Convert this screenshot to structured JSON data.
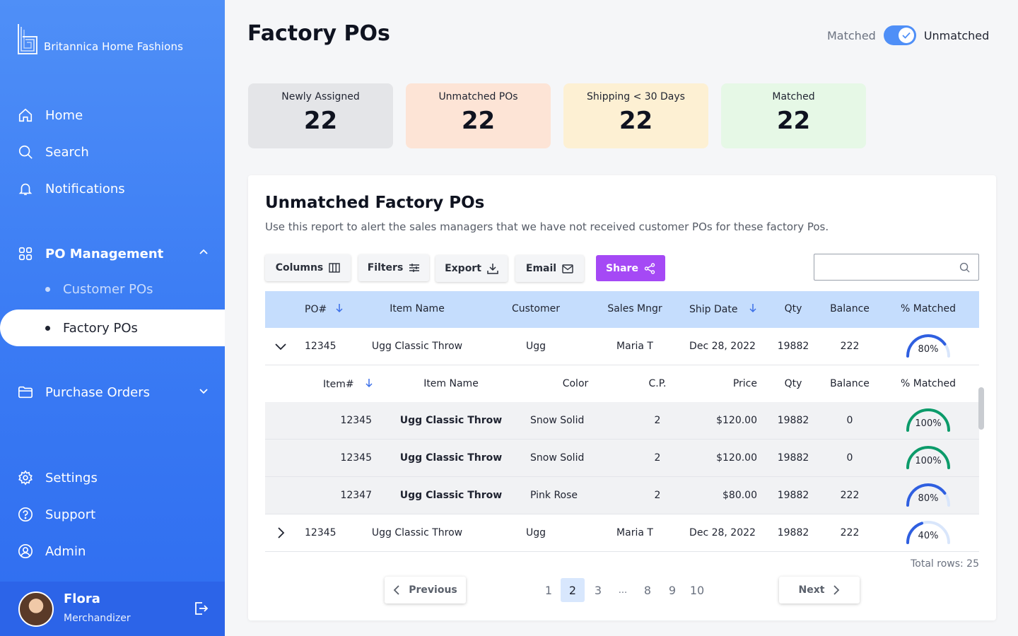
{
  "brand": {
    "name": "Britannica Home Fashions"
  },
  "sidebar": {
    "nav": [
      {
        "label": "Home",
        "icon": "home-icon"
      },
      {
        "label": "Search",
        "icon": "search-icon"
      },
      {
        "label": "Notifications",
        "icon": "bell-icon"
      }
    ],
    "po_management": {
      "label": "PO Management",
      "icon": "grid-icon",
      "expanded": true,
      "children": [
        {
          "label": "Customer POs"
        },
        {
          "label": "Factory POs",
          "active": true
        }
      ]
    },
    "purchase_orders": {
      "label": "Purchase Orders",
      "icon": "folder-icon",
      "expanded": false
    },
    "bottom": [
      {
        "label": "Settings",
        "icon": "gear-icon"
      },
      {
        "label": "Support",
        "icon": "help-icon"
      },
      {
        "label": "Admin",
        "icon": "user-circle-icon"
      }
    ],
    "user": {
      "name": "Flora",
      "role": "Merchandizer"
    }
  },
  "header": {
    "title": "Factory POs",
    "toggle": {
      "off_label": "Matched",
      "on_label": "Unmatched",
      "checked": true
    }
  },
  "stats": [
    {
      "label": "Newly Assigned",
      "value": "22",
      "color": "#e4e5e8"
    },
    {
      "label": "Unmatched POs",
      "value": "22",
      "color": "#fde4d6"
    },
    {
      "label": "Shipping < 30 Days",
      "value": "22",
      "color": "#fdf0d3"
    },
    {
      "label": "Matched",
      "value": "22",
      "color": "#e6f8e6"
    }
  ],
  "report": {
    "title": "Unmatched Factory POs",
    "subtitle": "Use this report to alert the sales managers that we have not received customer POs for these factory Pos.",
    "toolbar": {
      "columns": "Columns",
      "filters": "Filters",
      "export": "Export",
      "email": "Email",
      "share": "Share",
      "search_placeholder": ""
    },
    "columns": [
      "PO#",
      "Item Name",
      "Customer",
      "Sales Mngr",
      "Ship Date",
      "Qty",
      "Balance",
      "% Matched"
    ],
    "sub_columns": [
      "Item#",
      "Item Name",
      "Color",
      "C.P.",
      "Price",
      "Qty",
      "Balance",
      "% Matched"
    ],
    "rows": [
      {
        "po": "12345",
        "item": "Ugg Classic Throw",
        "customer": "Ugg",
        "mngr": "Maria T",
        "ship": "Dec 28, 2022",
        "qty": "19882",
        "balance": "222",
        "matched_label": "80%",
        "matched": 80,
        "expanded": true
      },
      {
        "po": "12345",
        "item": "Ugg Classic Throw",
        "customer": "Ugg",
        "mngr": "Maria T",
        "ship": "Dec 28, 2022",
        "qty": "19882",
        "balance": "222",
        "matched_label": "40%",
        "matched": 40,
        "expanded": false
      }
    ],
    "sub_rows": [
      {
        "item_no": "12345",
        "item": "Ugg Classic Throw",
        "color": "Snow Solid",
        "cp": "2",
        "price": "$120.00",
        "qty": "19882",
        "balance": "0",
        "matched_label": "100%",
        "matched": 100
      },
      {
        "item_no": "12345",
        "item": "Ugg Classic Throw",
        "color": "Snow Solid",
        "cp": "2",
        "price": "$120.00",
        "qty": "19882",
        "balance": "0",
        "matched_label": "100%",
        "matched": 100
      },
      {
        "item_no": "12347",
        "item": "Ugg Classic Throw",
        "color": "Pink Rose",
        "cp": "2",
        "price": "$80.00",
        "qty": "19882",
        "balance": "222",
        "matched_label": "80%",
        "matched": 80
      }
    ],
    "total_rows": "Total rows: 25",
    "pagination": {
      "previous": "Previous",
      "next": "Next",
      "pages": [
        "1",
        "2",
        "3",
        "...",
        "8",
        "9",
        "10"
      ],
      "current": "2"
    }
  },
  "colors": {
    "accent": "#4f8ff7",
    "share": "#a549f5",
    "gauge_blue": "#2f5fe0",
    "gauge_green": "#0c9b6a",
    "gauge_track": "#d9e6fb"
  }
}
